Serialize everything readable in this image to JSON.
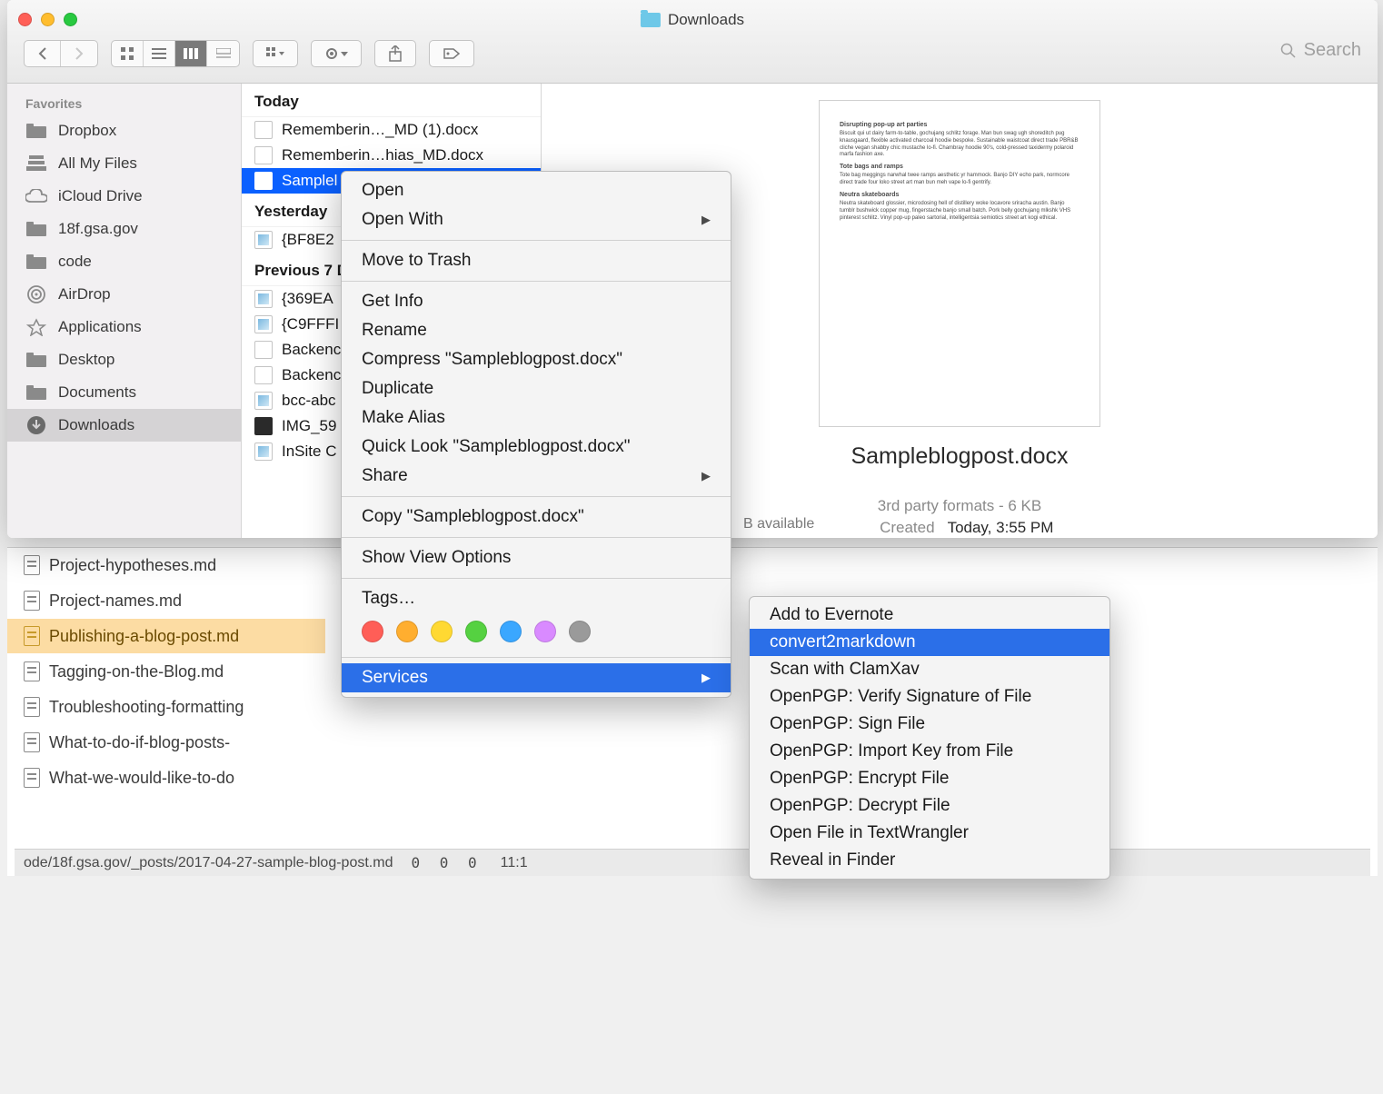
{
  "window": {
    "title": "Downloads"
  },
  "toolbar": {
    "search_placeholder": "Search"
  },
  "sidebar": {
    "heading": "Favorites",
    "items": [
      {
        "label": "Dropbox",
        "icon": "folder"
      },
      {
        "label": "All My Files",
        "icon": "all-files"
      },
      {
        "label": "iCloud Drive",
        "icon": "cloud"
      },
      {
        "label": "18f.gsa.gov",
        "icon": "folder"
      },
      {
        "label": "code",
        "icon": "folder"
      },
      {
        "label": "AirDrop",
        "icon": "airdrop"
      },
      {
        "label": "Applications",
        "icon": "apps"
      },
      {
        "label": "Desktop",
        "icon": "folder"
      },
      {
        "label": "Documents",
        "icon": "folder"
      },
      {
        "label": "Downloads",
        "icon": "download",
        "selected": true
      }
    ]
  },
  "file_list": {
    "groups": [
      {
        "label": "Today",
        "items": [
          {
            "name": "Rememberin…_MD (1).docx"
          },
          {
            "name": "Rememberin…hias_MD.docx"
          },
          {
            "name": "Samplel",
            "selected": true
          }
        ]
      },
      {
        "label": "Yesterday",
        "items": [
          {
            "name": "{BF8E2"
          }
        ]
      },
      {
        "label": "Previous 7 D",
        "items": [
          {
            "name": "{369EA"
          },
          {
            "name": "{C9FFFI"
          },
          {
            "name": "Backenc"
          },
          {
            "name": "Backenc"
          },
          {
            "name": "bcc-abc"
          },
          {
            "name": "IMG_59"
          },
          {
            "name": "InSite C"
          }
        ]
      }
    ]
  },
  "preview": {
    "filename": "Sampleblogpost.docx",
    "format_line": "3rd party formats - 6 KB",
    "created_label": "Created",
    "created_value": "Today, 3:55 PM",
    "doc_headings": [
      "Disrupting pop-up art parties",
      "Tote bags and ramps",
      "Neutra skateboards"
    ]
  },
  "status": {
    "available_suffix": "available"
  },
  "context_menu": {
    "open": "Open",
    "open_with": "Open With",
    "move_to_trash": "Move to Trash",
    "get_info": "Get Info",
    "rename": "Rename",
    "compress": "Compress \"Sampleblogpost.docx\"",
    "duplicate": "Duplicate",
    "make_alias": "Make Alias",
    "quick_look": "Quick Look \"Sampleblogpost.docx\"",
    "share": "Share",
    "copy": "Copy \"Sampleblogpost.docx\"",
    "show_view_options": "Show View Options",
    "tags": "Tags…",
    "services": "Services",
    "tag_colors": [
      "#ff5e57",
      "#ffae2f",
      "#ffd932",
      "#55d141",
      "#3aa7ff",
      "#d98aff",
      "#9a9a9a"
    ]
  },
  "services_menu": {
    "items": [
      "Add to Evernote",
      "convert2markdown",
      "Scan with ClamXav",
      "OpenPGP: Verify Signature of File",
      "OpenPGP: Sign File",
      "OpenPGP: Import Key from File",
      "OpenPGP: Encrypt File",
      "OpenPGP: Decrypt File",
      "Open File in TextWrangler",
      "Reveal in Finder"
    ],
    "selected_index": 1
  },
  "editor": {
    "files": [
      "Project-hypotheses.md",
      "Project-names.md",
      "Publishing-a-blog-post.md",
      "Tagging-on-the-Blog.md",
      "Troubleshooting-formatting",
      "What-to-do-if-blog-posts-",
      "What-we-would-like-to-do"
    ],
    "selected_index": 2,
    "status_path": "ode/18f.gsa.gov/_posts/2017-04-27-sample-blog-post.md",
    "status_counts": "0  0  0",
    "status_pos": "11:1"
  }
}
